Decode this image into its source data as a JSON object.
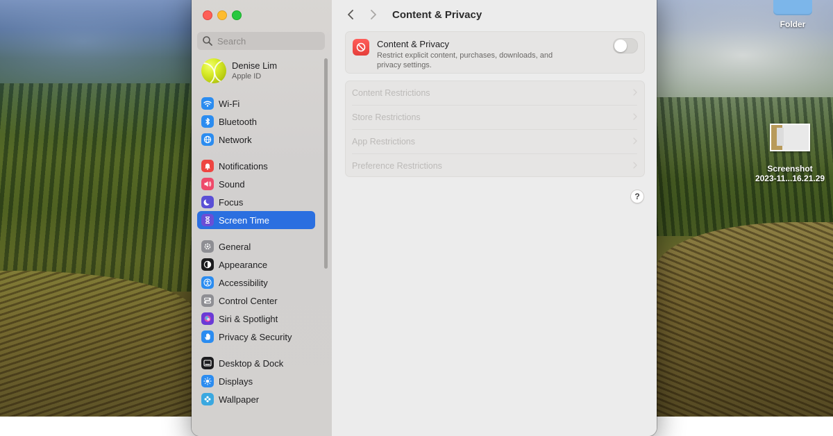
{
  "desktop": {
    "folder_label": "Folder",
    "screenshot_label_line1": "Screenshot",
    "screenshot_label_line2": "2023-11...16.21.29"
  },
  "sidebar": {
    "search_placeholder": "Search",
    "profile": {
      "name": "Denise Lim",
      "subtitle": "Apple ID"
    },
    "groups": [
      [
        {
          "label": "Wi-Fi",
          "icon": "wifi-icon",
          "color": "#2b8cf0"
        },
        {
          "label": "Bluetooth",
          "icon": "bluetooth-icon",
          "color": "#2b8cf0"
        },
        {
          "label": "Network",
          "icon": "globe-icon",
          "color": "#2b8cf0"
        }
      ],
      [
        {
          "label": "Notifications",
          "icon": "bell-icon",
          "color": "#ee4541"
        },
        {
          "label": "Sound",
          "icon": "speaker-icon",
          "color": "#ee4a6a"
        },
        {
          "label": "Focus",
          "icon": "moon-icon",
          "color": "#5a4fd6"
        },
        {
          "label": "Screen Time",
          "icon": "hourglass-icon",
          "color": "#6a4fd6",
          "active": true
        }
      ],
      [
        {
          "label": "General",
          "icon": "gear-icon",
          "color": "#8e8e93"
        },
        {
          "label": "Appearance",
          "icon": "appearance-icon",
          "color": "#1c1c1e"
        },
        {
          "label": "Accessibility",
          "icon": "accessibility-icon",
          "color": "#2b8cf0"
        },
        {
          "label": "Control Center",
          "icon": "control-center-icon",
          "color": "#8e8e93"
        },
        {
          "label": "Siri & Spotlight",
          "icon": "siri-icon",
          "color": "#6a3ad6"
        },
        {
          "label": "Privacy & Security",
          "icon": "hand-icon",
          "color": "#2b8cf0"
        }
      ],
      [
        {
          "label": "Desktop & Dock",
          "icon": "dock-icon",
          "color": "#1c1c1e"
        },
        {
          "label": "Displays",
          "icon": "sun-icon",
          "color": "#2b8cf0"
        },
        {
          "label": "Wallpaper",
          "icon": "flower-icon",
          "color": "#3aa8e0"
        }
      ]
    ]
  },
  "main": {
    "title": "Content & Privacy",
    "content_privacy": {
      "title": "Content & Privacy",
      "description": "Restrict explicit content, purchases, downloads, and privacy settings.",
      "enabled": false
    },
    "restrictions": [
      "Content Restrictions",
      "Store Restrictions",
      "App Restrictions",
      "Preference Restrictions"
    ],
    "help_label": "?"
  }
}
